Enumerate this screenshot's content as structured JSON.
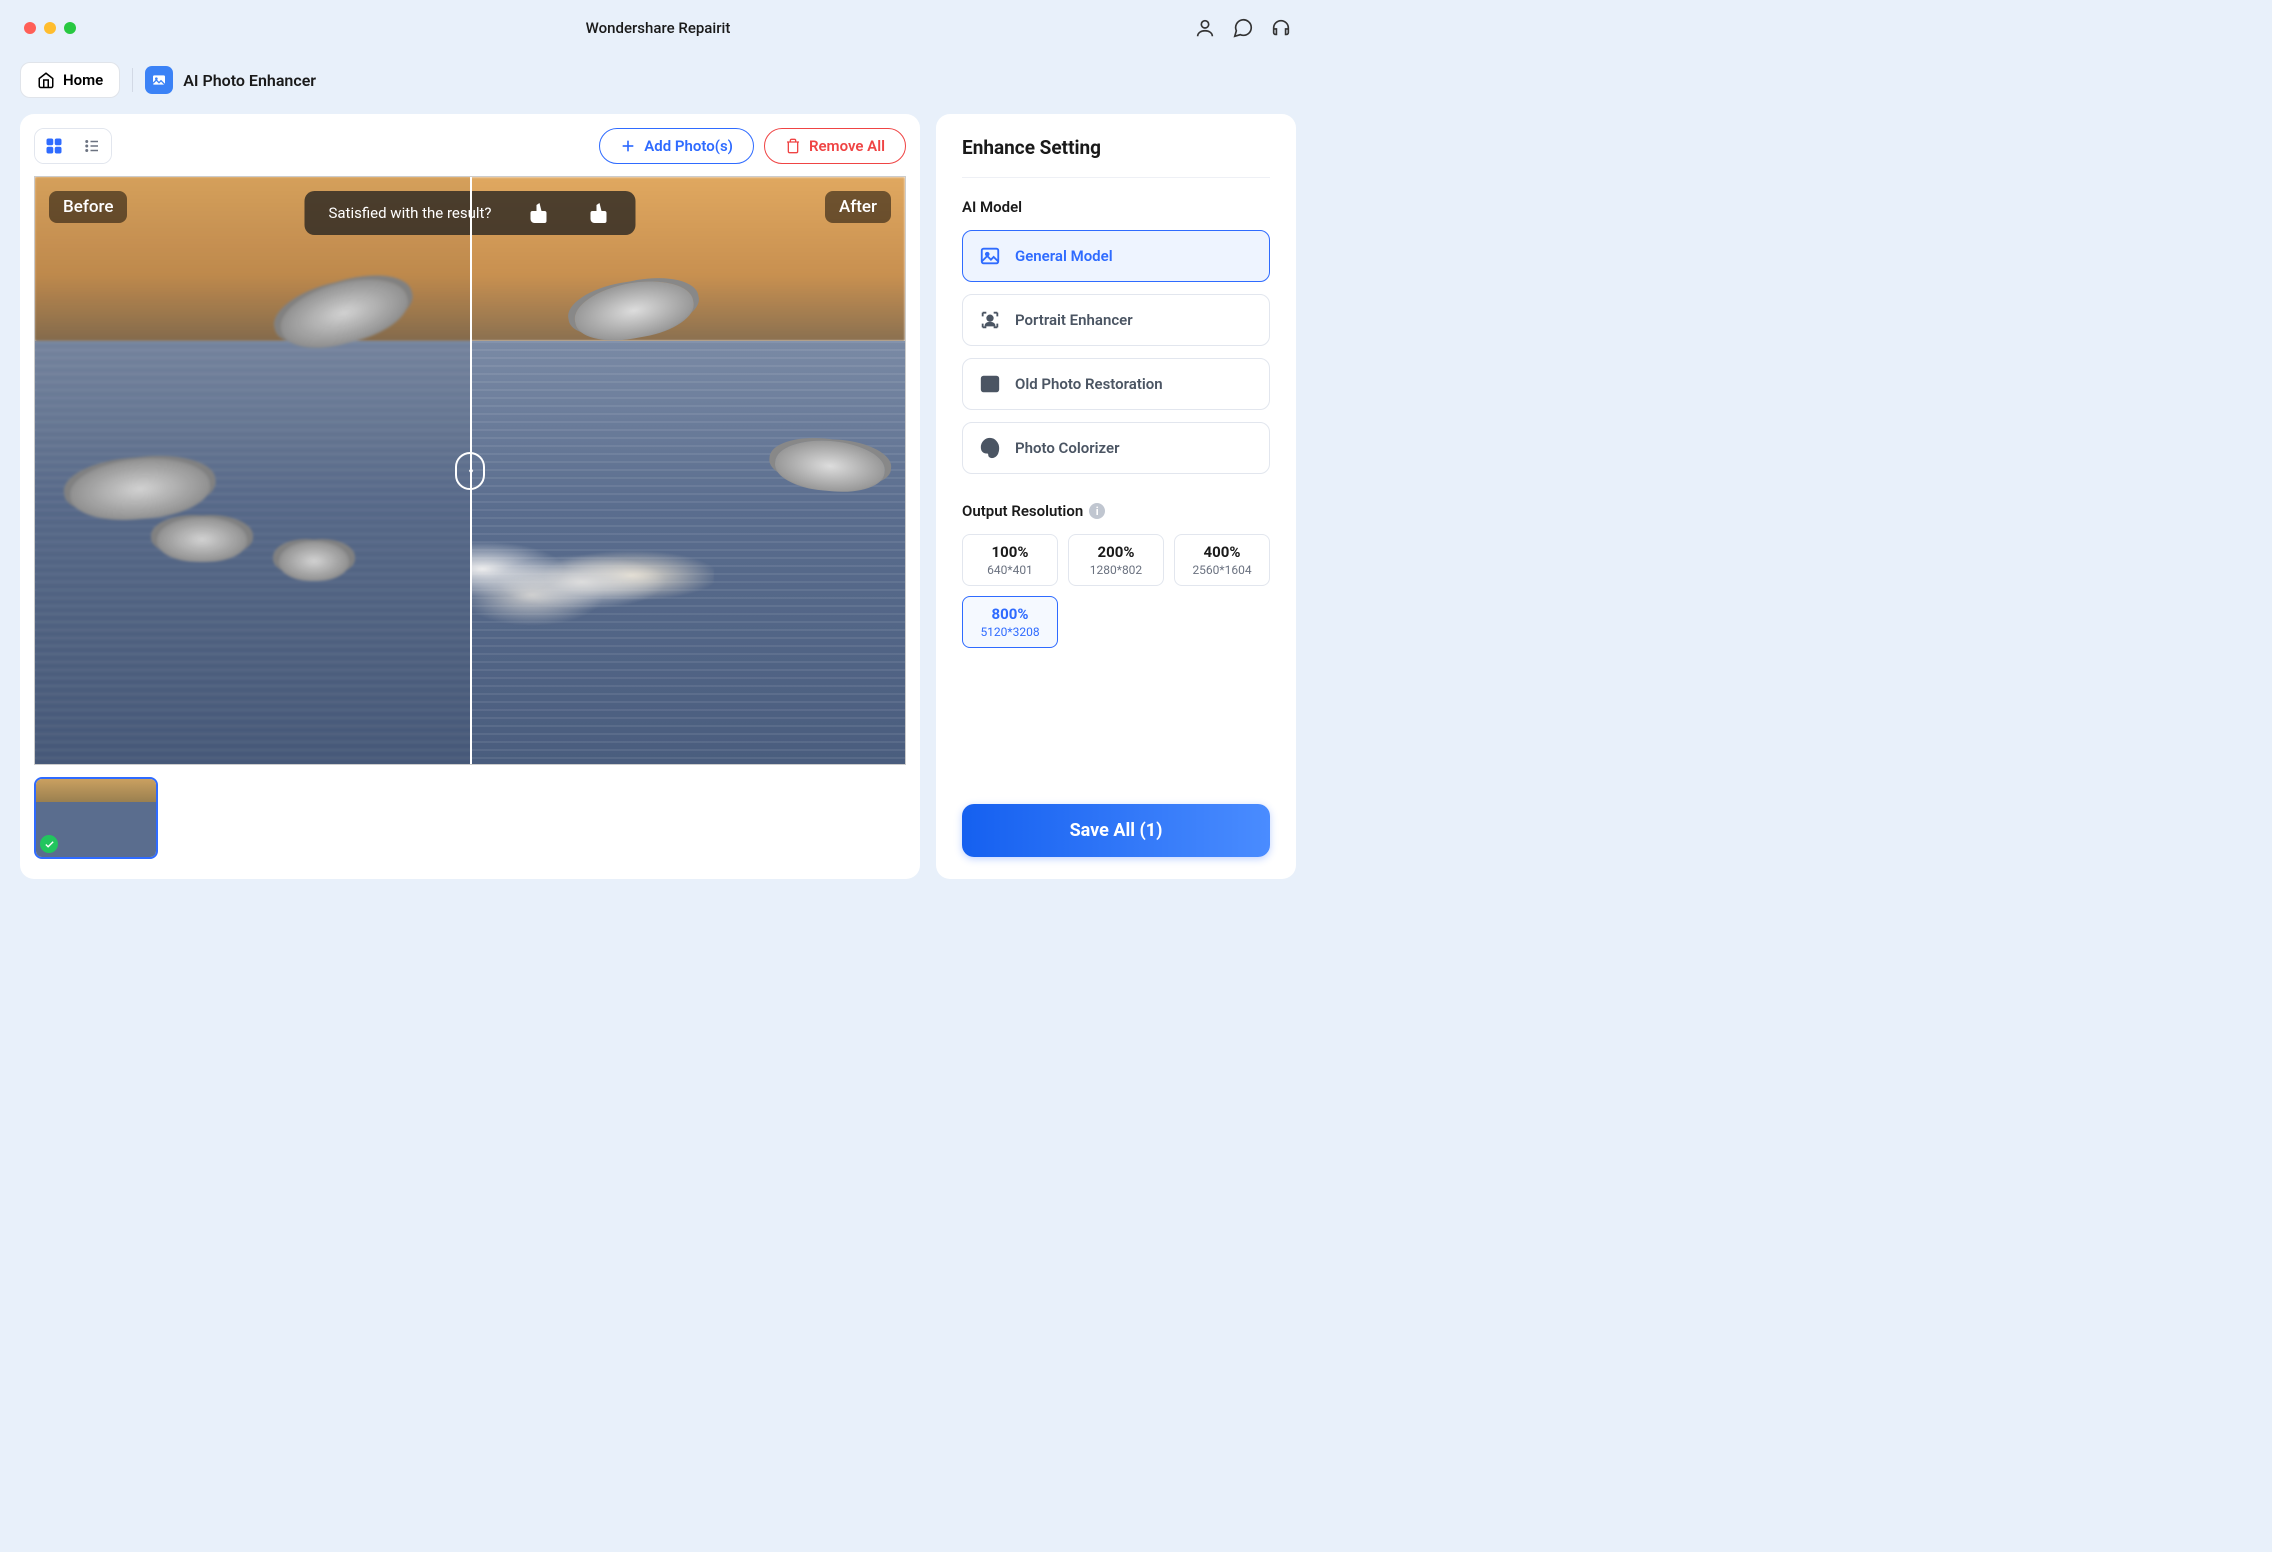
{
  "window": {
    "title": "Wondershare Repairit"
  },
  "topbar": {
    "home_label": "Home",
    "section_title": "AI Photo Enhancer"
  },
  "toolbar": {
    "add_label": "Add Photo(s)",
    "remove_label": "Remove All"
  },
  "preview": {
    "before_label": "Before",
    "after_label": "After",
    "feedback_text": "Satisfied with the result?"
  },
  "sidebar": {
    "title": "Enhance Setting",
    "model_group_label": "AI Model",
    "models": [
      {
        "label": "General Model",
        "selected": true
      },
      {
        "label": "Portrait Enhancer",
        "selected": false
      },
      {
        "label": "Old Photo Restoration",
        "selected": false
      },
      {
        "label": "Photo Colorizer",
        "selected": false
      }
    ],
    "resolution_group_label": "Output Resolution",
    "resolutions": [
      {
        "pct": "100%",
        "dim": "640*401",
        "selected": false
      },
      {
        "pct": "200%",
        "dim": "1280*802",
        "selected": false
      },
      {
        "pct": "400%",
        "dim": "2560*1604",
        "selected": false
      },
      {
        "pct": "800%",
        "dim": "5120*3208",
        "selected": true
      }
    ],
    "save_label": "Save All (1)"
  }
}
